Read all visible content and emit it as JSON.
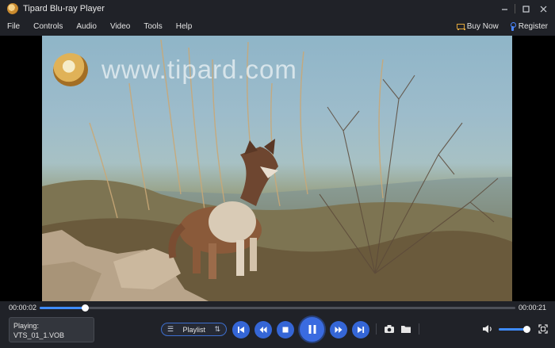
{
  "window": {
    "title": "Tipard Blu-ray Player",
    "controls": [
      "minimize-icon",
      "maximize-icon",
      "close-icon"
    ]
  },
  "menu": {
    "items": [
      "File",
      "Controls",
      "Audio",
      "Video",
      "Tools",
      "Help"
    ],
    "buy_now": "Buy Now",
    "register": "Register"
  },
  "video": {
    "watermark": "www.tipard.com",
    "description_icons": [
      "cheetah-logo-icon"
    ]
  },
  "progress": {
    "current_time": "00:00:02",
    "total_time": "00:00:21",
    "fraction": 0.095
  },
  "now_playing": {
    "label": "Playing:",
    "file": "VTS_01_1.VOB"
  },
  "playlist": {
    "label": "Playlist"
  },
  "buttons": {
    "icons": [
      "previous-icon",
      "rewind-icon",
      "stop-icon",
      "pause-icon",
      "fast-forward-icon",
      "next-icon",
      "snapshot-icon",
      "folder-icon",
      "volume-icon",
      "fullscreen-icon"
    ]
  },
  "volume": {
    "fraction": 0.9
  },
  "colors": {
    "accent": "#3566d6",
    "progress_fill": "#3f8cff",
    "background": "#202228"
  }
}
